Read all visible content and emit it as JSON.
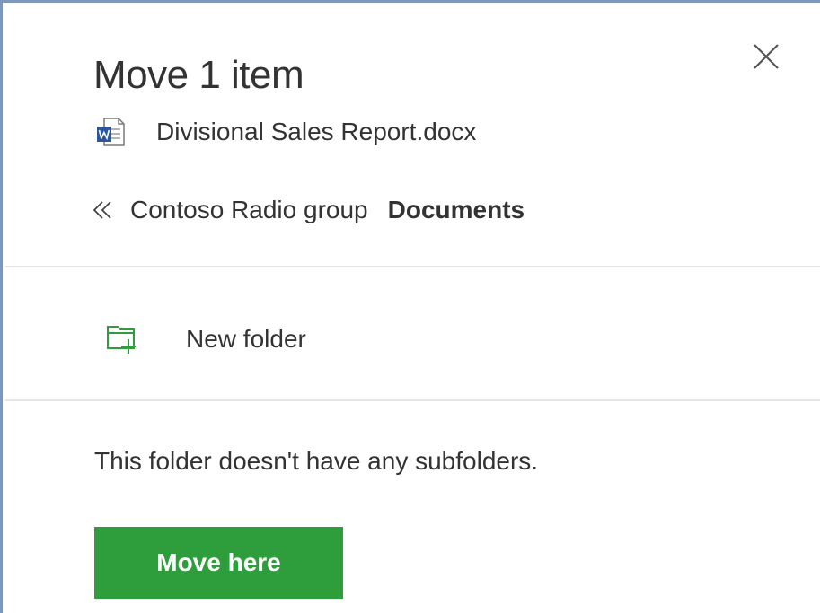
{
  "dialog": {
    "title": "Move 1 item",
    "close_icon": "close-icon"
  },
  "file": {
    "icon": "word-document-icon",
    "name": "Divisional Sales Report.docx"
  },
  "breadcrumb": {
    "back_icon": "double-chevron-left-icon",
    "parent": "Contoso Radio group",
    "current": "Documents"
  },
  "new_folder": {
    "icon": "new-folder-icon",
    "label": "New folder"
  },
  "folder_view": {
    "empty_message": "This folder doesn't have any subfolders."
  },
  "actions": {
    "move_here_label": "Move here"
  },
  "colors": {
    "accent_green": "#2e9e3c",
    "window_border": "#7f97b8",
    "text": "#333333",
    "divider": "#e6e6e6",
    "word_blue": "#2b579a"
  }
}
